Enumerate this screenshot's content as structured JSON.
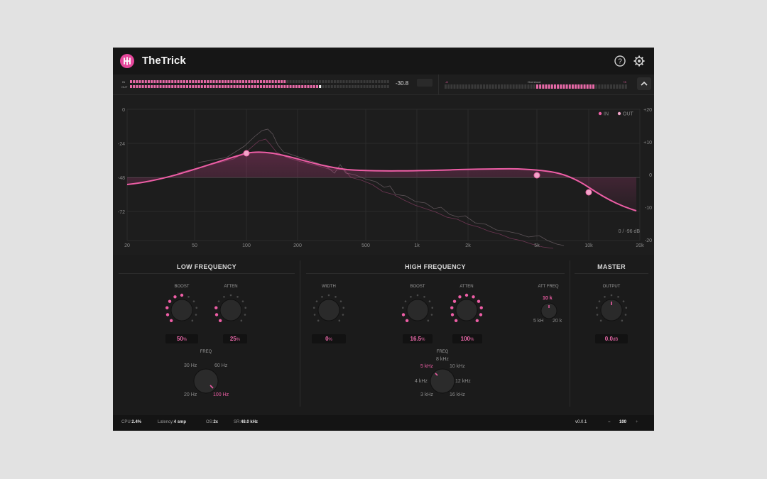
{
  "app": {
    "title": "TheTrick"
  },
  "header": {
    "help_icon": "help-icon",
    "settings_icon": "gear-icon"
  },
  "meters": {
    "in_label": "IN",
    "out_label": "OUT",
    "value": "-30.8",
    "right_label": "Overshoot",
    "right_value_left": "-6",
    "right_value_right": "+3",
    "in_level": 0.6,
    "out_level": 0.74,
    "right_level": 0.82
  },
  "graph": {
    "left_ticks": [
      "0",
      "-24",
      "-48",
      "-72"
    ],
    "right_ticks": [
      "+20",
      "+10",
      "0",
      "-10",
      "-20"
    ],
    "freq_ticks": [
      "20",
      "50",
      "100",
      "200",
      "500",
      "1k",
      "2k",
      "5k",
      "10k",
      "20k"
    ],
    "legend": {
      "in": "IN",
      "out": "OUT"
    },
    "range_label": "0 / -96 dB"
  },
  "low": {
    "title": "LOW FREQUENCY",
    "boost": {
      "label": "BOOST",
      "value": "50",
      "unit": "%"
    },
    "atten": {
      "label": "ATTEN",
      "value": "25",
      "unit": "%"
    },
    "freq": {
      "label": "FREQ",
      "options": [
        "30 Hz",
        "60 Hz",
        "20 Hz",
        "100 Hz"
      ],
      "selected": "100 Hz"
    }
  },
  "high": {
    "title": "HIGH FREQUENCY",
    "width": {
      "label": "WIDTH",
      "value": "0",
      "unit": "%"
    },
    "boost": {
      "label": "BOOST",
      "value": "16.5",
      "unit": "%"
    },
    "atten": {
      "label": "ATTEN",
      "value": "100",
      "unit": "%"
    },
    "att_freq": {
      "label": "ATT FREQ",
      "selected": "10 k",
      "min": "5 kH",
      "max": "20 k"
    },
    "freq": {
      "label": "FREQ",
      "options": [
        "8 kHz",
        "5 kHz",
        "10 kHz",
        "4 kHz",
        "12 kHz",
        "3 kHz",
        "16 kHz"
      ],
      "selected": "5 kHz"
    }
  },
  "master": {
    "title": "MASTER",
    "output": {
      "label": "OUTPUT",
      "value": "0.0",
      "unit": "dB"
    }
  },
  "status": {
    "cpu_label": "CPU:",
    "cpu": "2.4%",
    "latency_label": "Latency:",
    "latency": "4 smp",
    "os_label": "OS:",
    "os": "2x",
    "sr_label": "SR:",
    "sr": "48.0 kHz",
    "version": "v0.0.1",
    "zoom_minus": "−",
    "zoom": "100",
    "zoom_plus": "+"
  },
  "colors": {
    "accent": "#e5479b",
    "bg": "#1c1c1c"
  }
}
